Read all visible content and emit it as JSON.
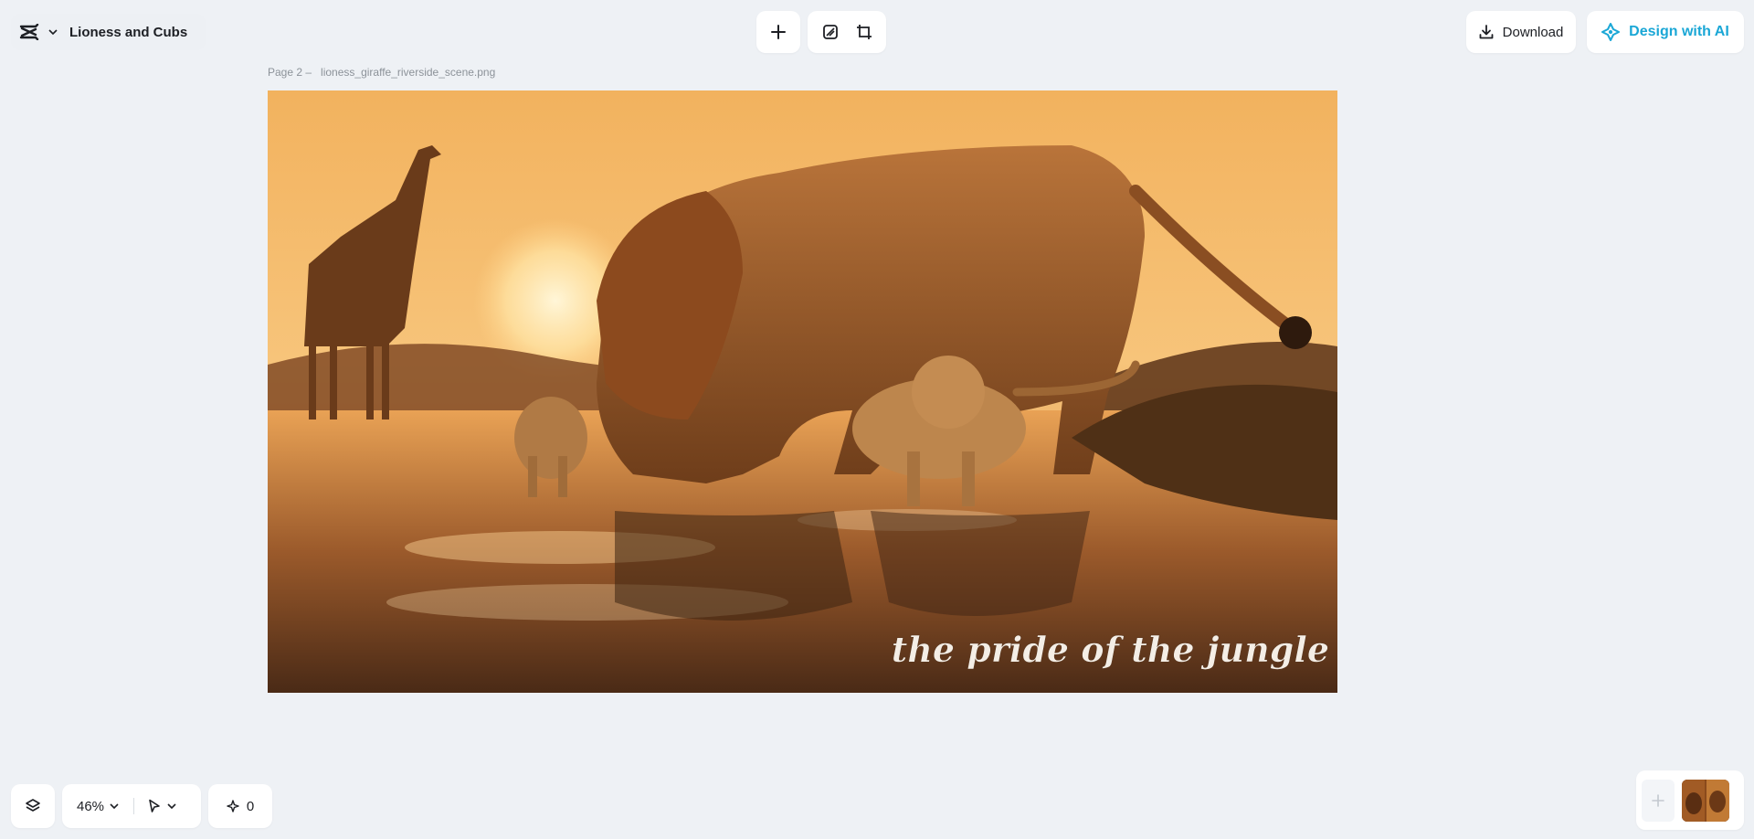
{
  "header": {
    "project_name": "Lioness and Cubs",
    "download_label": "Download",
    "ai_button_label": "Design with AI"
  },
  "page_label": {
    "page": "Page 2 –",
    "filename": "lioness_giraffe_riverside_scene.png"
  },
  "canvas": {
    "overlay_text": "the pride of the jungle"
  },
  "footer": {
    "zoom": "46%",
    "ai_count": "0"
  },
  "colors": {
    "background": "#eef1f5",
    "accent": "#1aa7d6"
  },
  "icons": [
    "capcut-logo-icon",
    "chevron-down-icon",
    "plus-icon",
    "resize-icon",
    "crop-icon",
    "download-icon",
    "ai-sparkle-icon",
    "layers-icon",
    "pointer-icon",
    "sparkle-icon"
  ]
}
